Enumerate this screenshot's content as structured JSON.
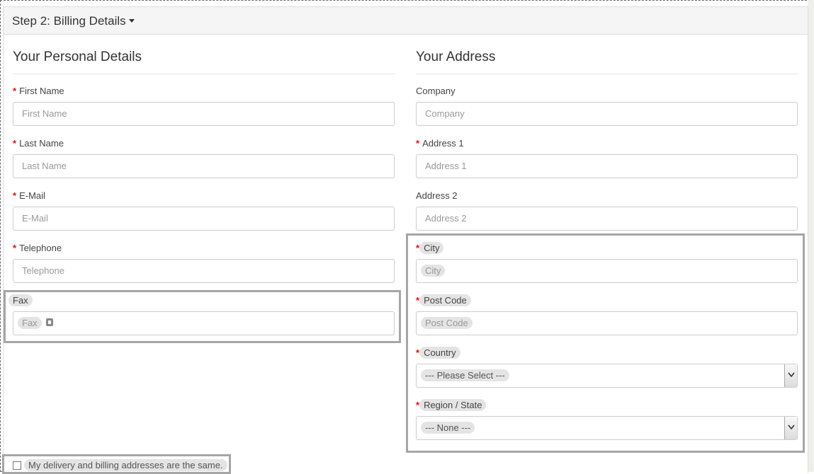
{
  "panel": {
    "title": "Step 2: Billing Details"
  },
  "personal": {
    "legend": "Your Personal Details",
    "fields": [
      {
        "label": "First Name",
        "placeholder": "First Name",
        "required": true
      },
      {
        "label": "Last Name",
        "placeholder": "Last Name",
        "required": true
      },
      {
        "label": "E-Mail",
        "placeholder": "E-Mail",
        "required": true
      },
      {
        "label": "Telephone",
        "placeholder": "Telephone",
        "required": true
      },
      {
        "label": "Fax",
        "placeholder": "Fax",
        "required": false
      }
    ]
  },
  "address": {
    "legend": "Your Address",
    "fields": [
      {
        "label": "Company",
        "placeholder": "Company",
        "required": false
      },
      {
        "label": "Address 1",
        "placeholder": "Address 1",
        "required": true
      },
      {
        "label": "Address 2",
        "placeholder": "Address 2",
        "required": false
      },
      {
        "label": "City",
        "placeholder": "City",
        "required": true
      },
      {
        "label": "Post Code",
        "placeholder": "Post Code",
        "required": true
      }
    ],
    "country": {
      "label": "Country",
      "selected": "--- Please Select ---",
      "required": true
    },
    "region": {
      "label": "Region / State",
      "selected": "--- None ---",
      "required": true
    }
  },
  "same_address": {
    "label": "My delivery and billing addresses are the same.",
    "checked": false
  },
  "required_mark": "*"
}
